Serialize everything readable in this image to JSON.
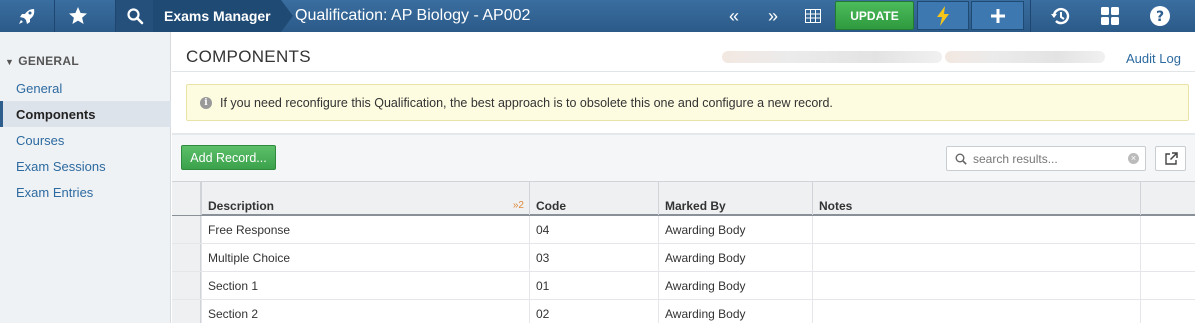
{
  "topbar": {
    "app_name": "Exams Manager",
    "record_title": "Qualification: AP Biology - AP002",
    "update_label": "UPDATE",
    "icons": [
      "rocket-icon",
      "star-icon",
      "search-icon",
      "first-page-icon",
      "next-page-icon",
      "grid-view-icon",
      "bolt-icon",
      "plus-icon",
      "history-icon",
      "apps-icon",
      "help-icon"
    ]
  },
  "sidebar": {
    "section_title": "GENERAL",
    "items": [
      {
        "label": "General",
        "active": false
      },
      {
        "label": "Components",
        "active": true
      },
      {
        "label": "Courses",
        "active": false
      },
      {
        "label": "Exam Sessions",
        "active": false
      },
      {
        "label": "Exam Entries",
        "active": false
      }
    ]
  },
  "main": {
    "title": "COMPONENTS",
    "audit_log_label": "Audit Log",
    "notice_text": "If you need reconfigure this Qualification, the best approach is to obsolete this one and configure a new record.",
    "add_record_label": "Add Record...",
    "search_placeholder": "search results...",
    "table": {
      "columns": [
        {
          "label": "Description",
          "sort": "»2"
        },
        {
          "label": "Code"
        },
        {
          "label": "Marked By"
        },
        {
          "label": "Notes"
        }
      ],
      "rows": [
        {
          "description": "Free Response",
          "code": "04",
          "marked_by": "Awarding Body",
          "notes": ""
        },
        {
          "description": "Multiple Choice",
          "code": "03",
          "marked_by": "Awarding Body",
          "notes": ""
        },
        {
          "description": "Section 1",
          "code": "01",
          "marked_by": "Awarding Body",
          "notes": ""
        },
        {
          "description": "Section 2",
          "code": "02",
          "marked_by": "Awarding Body",
          "notes": ""
        }
      ]
    }
  },
  "colors": {
    "topbar": "#2d5e8e",
    "update_green": "#3ba14a",
    "link_blue": "#2d6aa0",
    "notice_bg": "#fdfbe0"
  }
}
